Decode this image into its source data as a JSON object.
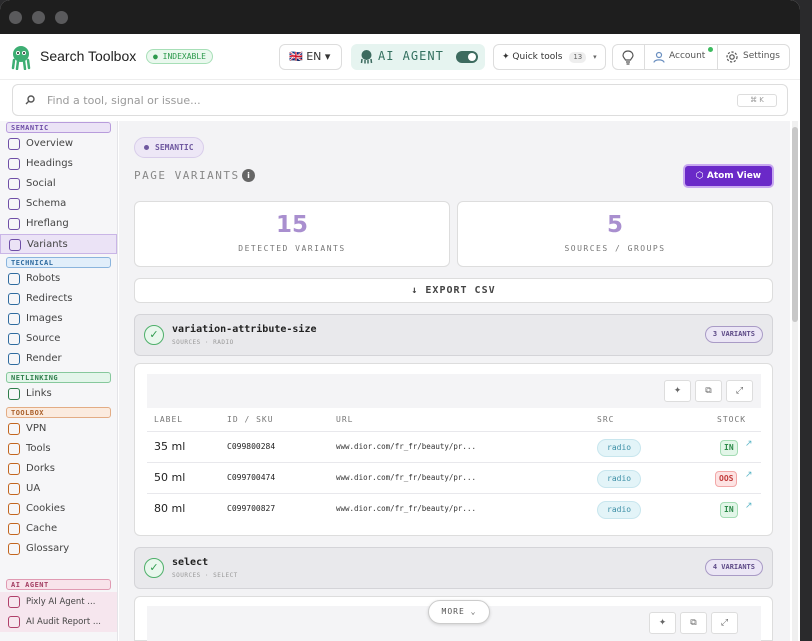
{
  "app": {
    "title": "Search Toolbox",
    "indexable": "● INDEXABLE"
  },
  "header": {
    "lang": "🇬🇧 EN ▾",
    "agent_label": "AI AGENT",
    "quick_tools": "✦ Quick tools",
    "quick_tools_count": "13",
    "account": "Account",
    "settings": "Settings"
  },
  "search": {
    "placeholder": "Find a tool, signal or issue...",
    "shortcut": "⌘ K"
  },
  "sidebar": {
    "sections": [
      {
        "label": "SEMANTIC",
        "color": "#ebe3f6",
        "border": "#b89cdc",
        "text": "#6f4fa7"
      },
      {
        "label": "TECHNICAL",
        "color": "#e1eefa",
        "border": "#8ab4dd",
        "text": "#2f6b9f"
      },
      {
        "label": "NETLINKING",
        "color": "#e3f5ea",
        "border": "#86c89c",
        "text": "#2e7d4b"
      },
      {
        "label": "TOOLBOX",
        "color": "#fbebdf",
        "border": "#e3ac84",
        "text": "#a95f2a"
      },
      {
        "label": "AI AGENT",
        "color": "#f8e3ea",
        "border": "#e09ab2",
        "text": "#a33e62"
      }
    ],
    "items": [
      "Overview",
      "Headings",
      "Social",
      "Schema",
      "Hreflang",
      "Variants",
      "Robots",
      "Redirects",
      "Images",
      "Source",
      "Render",
      "Links",
      "VPN",
      "Tools",
      "Dorks",
      "UA",
      "Cookies",
      "Cache",
      "Glossary",
      "Pixly AI Agent ...",
      "AI Audit Report ..."
    ]
  },
  "main": {
    "section_pill": "SEMANTIC",
    "title": "PAGE VARIANTS",
    "atom_view": "⬡ Atom View",
    "stats": [
      {
        "value": "15",
        "label": "DETECTED VARIANTS"
      },
      {
        "value": "5",
        "label": "SOURCES / GROUPS"
      }
    ],
    "export": "↓ EXPORT CSV",
    "groups": [
      {
        "name": "variation-attribute-size",
        "sub": "SOURCES · RADIO",
        "badge": "3 VARIANTS"
      },
      {
        "name": "select",
        "sub": "SOURCES · SELECT",
        "badge": "4 VARIANTS"
      }
    ],
    "table": {
      "headers": [
        "LABEL",
        "ID / SKU",
        "URL",
        "SRC",
        "STOCK"
      ],
      "rows": [
        {
          "label": "35 ml",
          "id": "C099800284",
          "url": "www.dior.com/fr_fr/beauty/pr...",
          "src": "radio",
          "stock": "IN"
        },
        {
          "label": "50 ml",
          "id": "C099700474",
          "url": "www.dior.com/fr_fr/beauty/pr...",
          "src": "radio",
          "stock": "OOS"
        },
        {
          "label": "80 ml",
          "id": "C099700827",
          "url": "www.dior.com/fr_fr/beauty/pr...",
          "src": "radio",
          "stock": "IN"
        }
      ]
    },
    "more": "MORE ⌄"
  }
}
